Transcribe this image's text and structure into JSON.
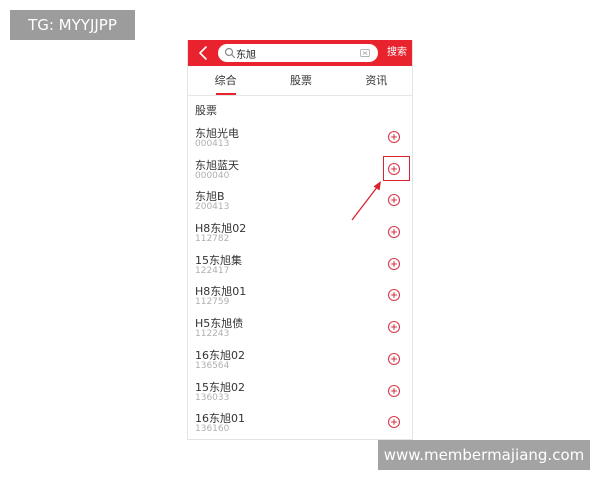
{
  "tag": "TG: MYYJJPP",
  "watermark": "www.membermajiang.com",
  "header": {
    "search_value": "东旭",
    "search_button": "搜索"
  },
  "tabs": [
    {
      "label": "综合",
      "active": true
    },
    {
      "label": "股票",
      "active": false
    },
    {
      "label": "资讯",
      "active": false
    }
  ],
  "section_title": "股票",
  "stocks": [
    {
      "name": "东旭光电",
      "code": "000413"
    },
    {
      "name": "东旭蓝天",
      "code": "000040"
    },
    {
      "name": "东旭B",
      "code": "200413"
    },
    {
      "name": "H8东旭02",
      "code": "112782"
    },
    {
      "name": "15东旭集",
      "code": "122417"
    },
    {
      "name": "H8东旭01",
      "code": "112759"
    },
    {
      "name": "H5东旭债",
      "code": "112243"
    },
    {
      "name": "16东旭02",
      "code": "136564"
    },
    {
      "name": "15东旭02",
      "code": "136033"
    },
    {
      "name": "16东旭01",
      "code": "136160"
    }
  ],
  "colors": {
    "brand_red": "#e8232e",
    "add_icon": "#d43c4a"
  },
  "icons": {
    "back": "chevron-left-icon",
    "search": "search-icon",
    "clear": "clear-icon",
    "add": "plus-circle-icon"
  }
}
